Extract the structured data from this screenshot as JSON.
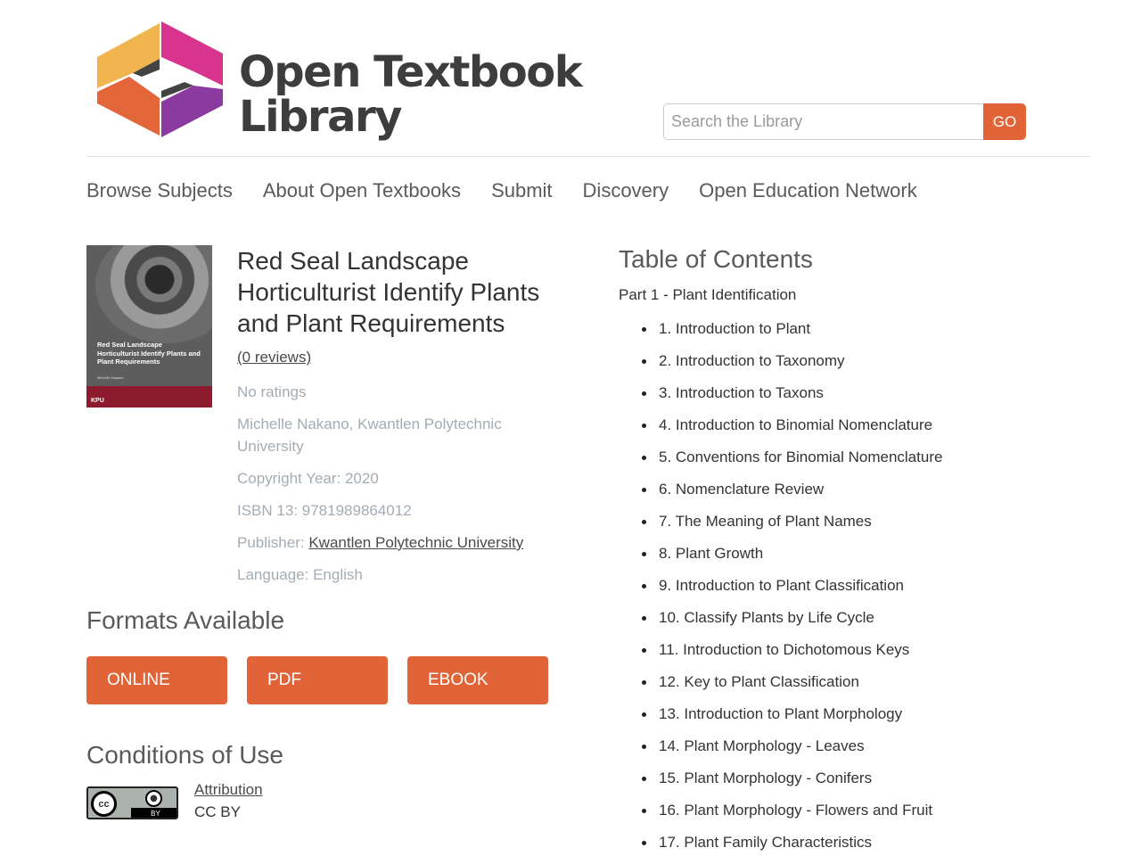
{
  "header": {
    "logo_line1": "Open Textbook",
    "logo_line2": "Library",
    "search_placeholder": "Search the Library",
    "search_button": "GO"
  },
  "nav": [
    "Browse Subjects",
    "About Open Textbooks",
    "Submit",
    "Discovery",
    "Open Education Network"
  ],
  "book": {
    "cover_title": "Red Seal Landscape Horticulturist Identify Plants and Plant Requirements",
    "cover_author": "Michelle Nakano",
    "cover_logo": "KPU",
    "title": "Red Seal Landscape Horticulturist Identify Plants and Plant Requirements",
    "reviews": "(0 reviews)",
    "ratings": "No ratings",
    "authors": "Michelle Nakano, Kwantlen Polytechnic University",
    "copyright": "Copyright Year: 2020",
    "isbn": "ISBN 13: 9781989864012",
    "publisher_label": "Publisher: ",
    "publisher": "Kwantlen Polytechnic University",
    "language": "Language: English"
  },
  "formats": {
    "heading": "Formats Available",
    "buttons": [
      "ONLINE",
      "PDF",
      "EBOOK"
    ]
  },
  "conditions": {
    "heading": "Conditions of Use",
    "license_name": "Attribution",
    "license_code": "CC BY",
    "badge_text": "BY",
    "badge_cc": "cc"
  },
  "toc": {
    "heading": "Table of Contents",
    "part": "Part 1 - Plant Identification",
    "items": [
      "1. Introduction to Plant",
      "2. Introduction to Taxonomy",
      "3. Introduction to Taxons",
      "4. Introduction to Binomial Nomenclature",
      "5. Conventions for Binomial Nomenclature",
      "6. Nomenclature Review",
      "7. The Meaning of Plant Names",
      "8. Plant Growth",
      "9. Introduction to Plant Classification",
      "10. Classify Plants by Life Cycle",
      "11. Introduction to Dichotomous Keys",
      "12. Key to Plant Classification",
      "13. Introduction to Plant Morphology",
      "14. Plant Morphology - Leaves",
      "15. Plant Morphology - Conifers",
      "16. Plant Morphology - Flowers and Fruit",
      "17. Plant Family Characteristics"
    ]
  },
  "colors": {
    "accent": "#e06437",
    "logo_yellow": "#f0b54f",
    "logo_pink": "#d8338f",
    "logo_orange": "#e3653a",
    "logo_purple": "#8b3aa0"
  }
}
